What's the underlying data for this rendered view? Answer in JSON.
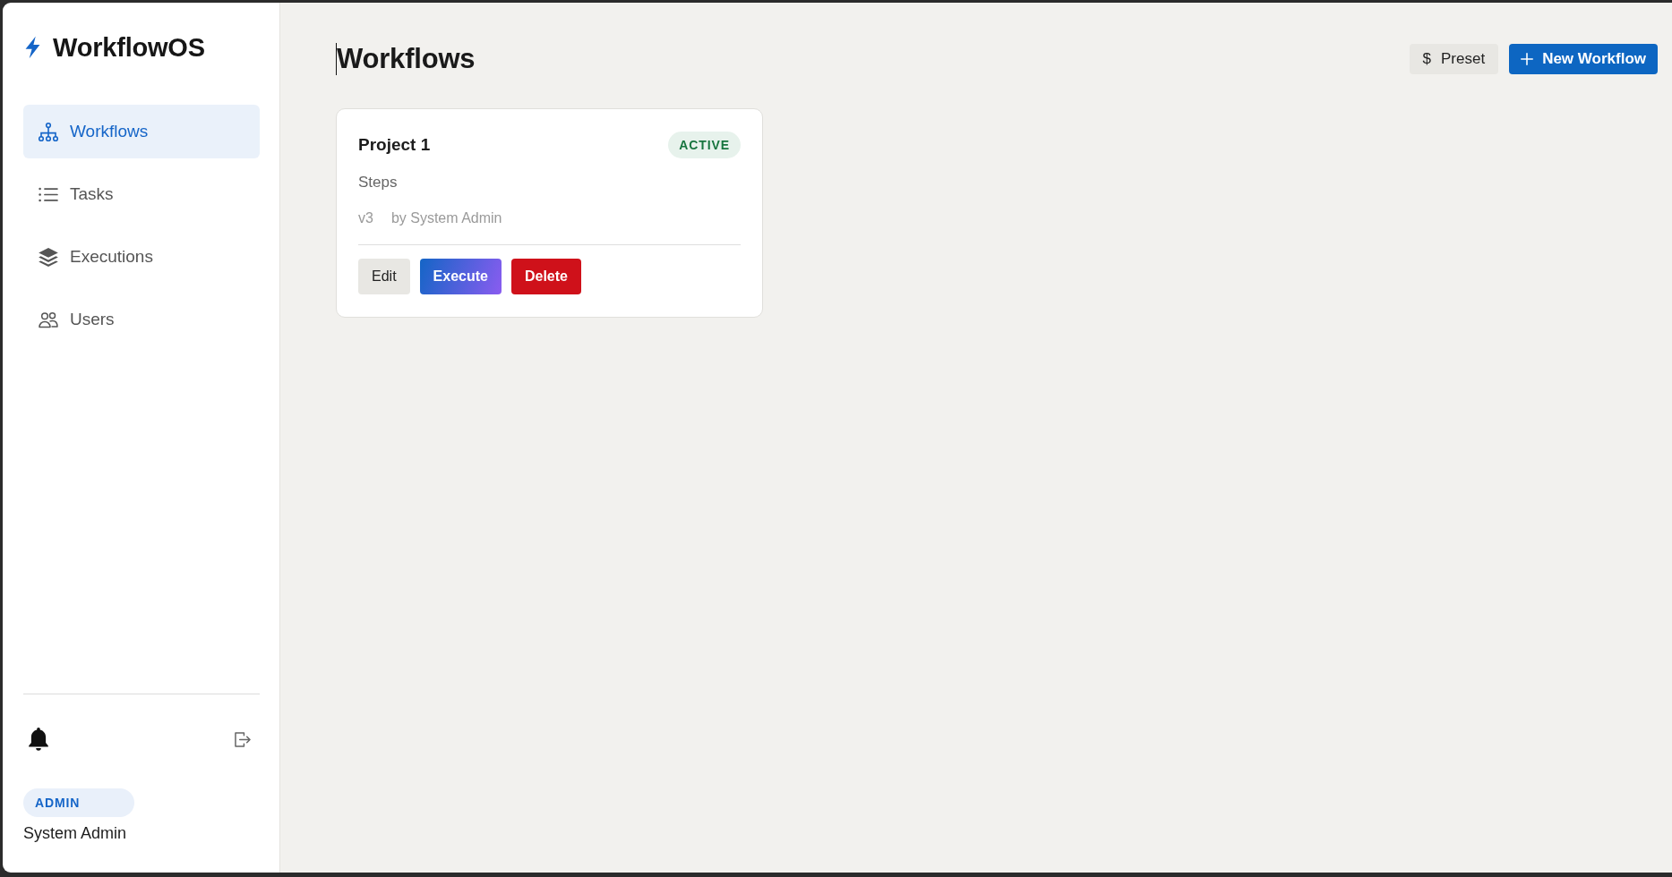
{
  "sidebar": {
    "logo": "WorkflowOS",
    "nav_items": [
      {
        "kind": "hierarchy",
        "label": "Workflows",
        "selected": true
      },
      {
        "kind": "list",
        "label": "Tasks",
        "selected": false
      },
      {
        "kind": "layers",
        "label": "Executions",
        "selected": false
      },
      {
        "kind": "users",
        "label": "Users",
        "selected": false
      }
    ],
    "user": {
      "role": "ADMIN",
      "name": "System Admin"
    }
  },
  "header": {
    "title": "Workflows",
    "buttons": [
      {
        "kind": "secondary",
        "glyph": "$",
        "label": "Preset"
      },
      {
        "kind": "primary",
        "label": "New Workflow"
      }
    ]
  },
  "workflows": [
    {
      "title": "Project 1",
      "status": "ACTIVE",
      "description": "Steps",
      "version": "v3",
      "author": "by System Admin",
      "actions": [
        {
          "kind": "neutral",
          "label": "Edit"
        },
        {
          "kind": "gradient",
          "label": "Execute"
        },
        {
          "kind": "danger",
          "label": "Delete"
        }
      ]
    }
  ]
}
